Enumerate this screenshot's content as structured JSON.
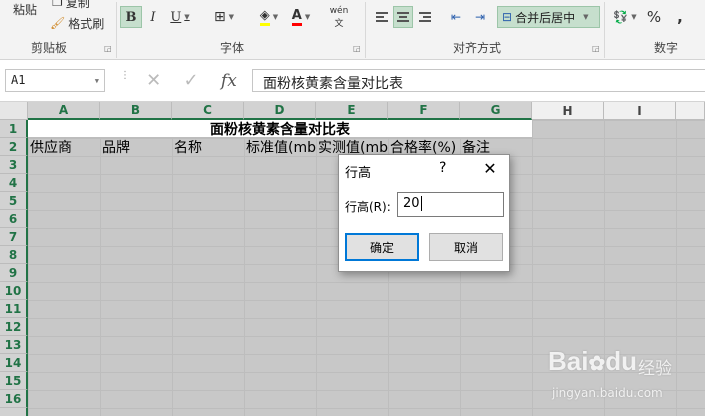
{
  "ribbon": {
    "clipboard": {
      "paste": "粘贴",
      "copy": "复制",
      "format_painter": "格式刷",
      "group": "剪贴板"
    },
    "font": {
      "bold": "B",
      "italic": "I",
      "underline": "U",
      "font_color_glyph": "A",
      "phonetic": "wén",
      "group": "字体"
    },
    "alignment": {
      "merge_center": "合并后居中",
      "group": "对齐方式"
    },
    "number": {
      "percent": "%",
      "comma": ",",
      "group": "数字"
    },
    "accent": "#217346",
    "highlight": "#ffff00",
    "font_red": "#ff0000"
  },
  "formula_bar": {
    "name_box": "A1",
    "fx": "fx",
    "formula": "面粉核黄素含量对比表"
  },
  "sheet": {
    "columns": [
      "A",
      "B",
      "C",
      "D",
      "E",
      "F",
      "G",
      "H",
      "I"
    ],
    "rows": [
      "1",
      "2",
      "3",
      "4",
      "5",
      "6",
      "7",
      "8",
      "9",
      "10",
      "11",
      "12",
      "13",
      "14",
      "15",
      "16"
    ],
    "title": "面粉核黄素含量对比表",
    "headers": [
      "供应商",
      "品牌",
      "名称",
      "标准值(mb",
      "实测值(mb",
      "合格率(%)",
      "备注"
    ]
  },
  "dialog": {
    "title": "行高",
    "help": "?",
    "close": "✕",
    "label": "行高(R):",
    "value": "20",
    "ok": "确定",
    "cancel": "取消"
  },
  "watermark": {
    "brand": "Bai",
    "brand2": "du",
    "cn": "经验",
    "url": "jingyan.baidu.com"
  }
}
